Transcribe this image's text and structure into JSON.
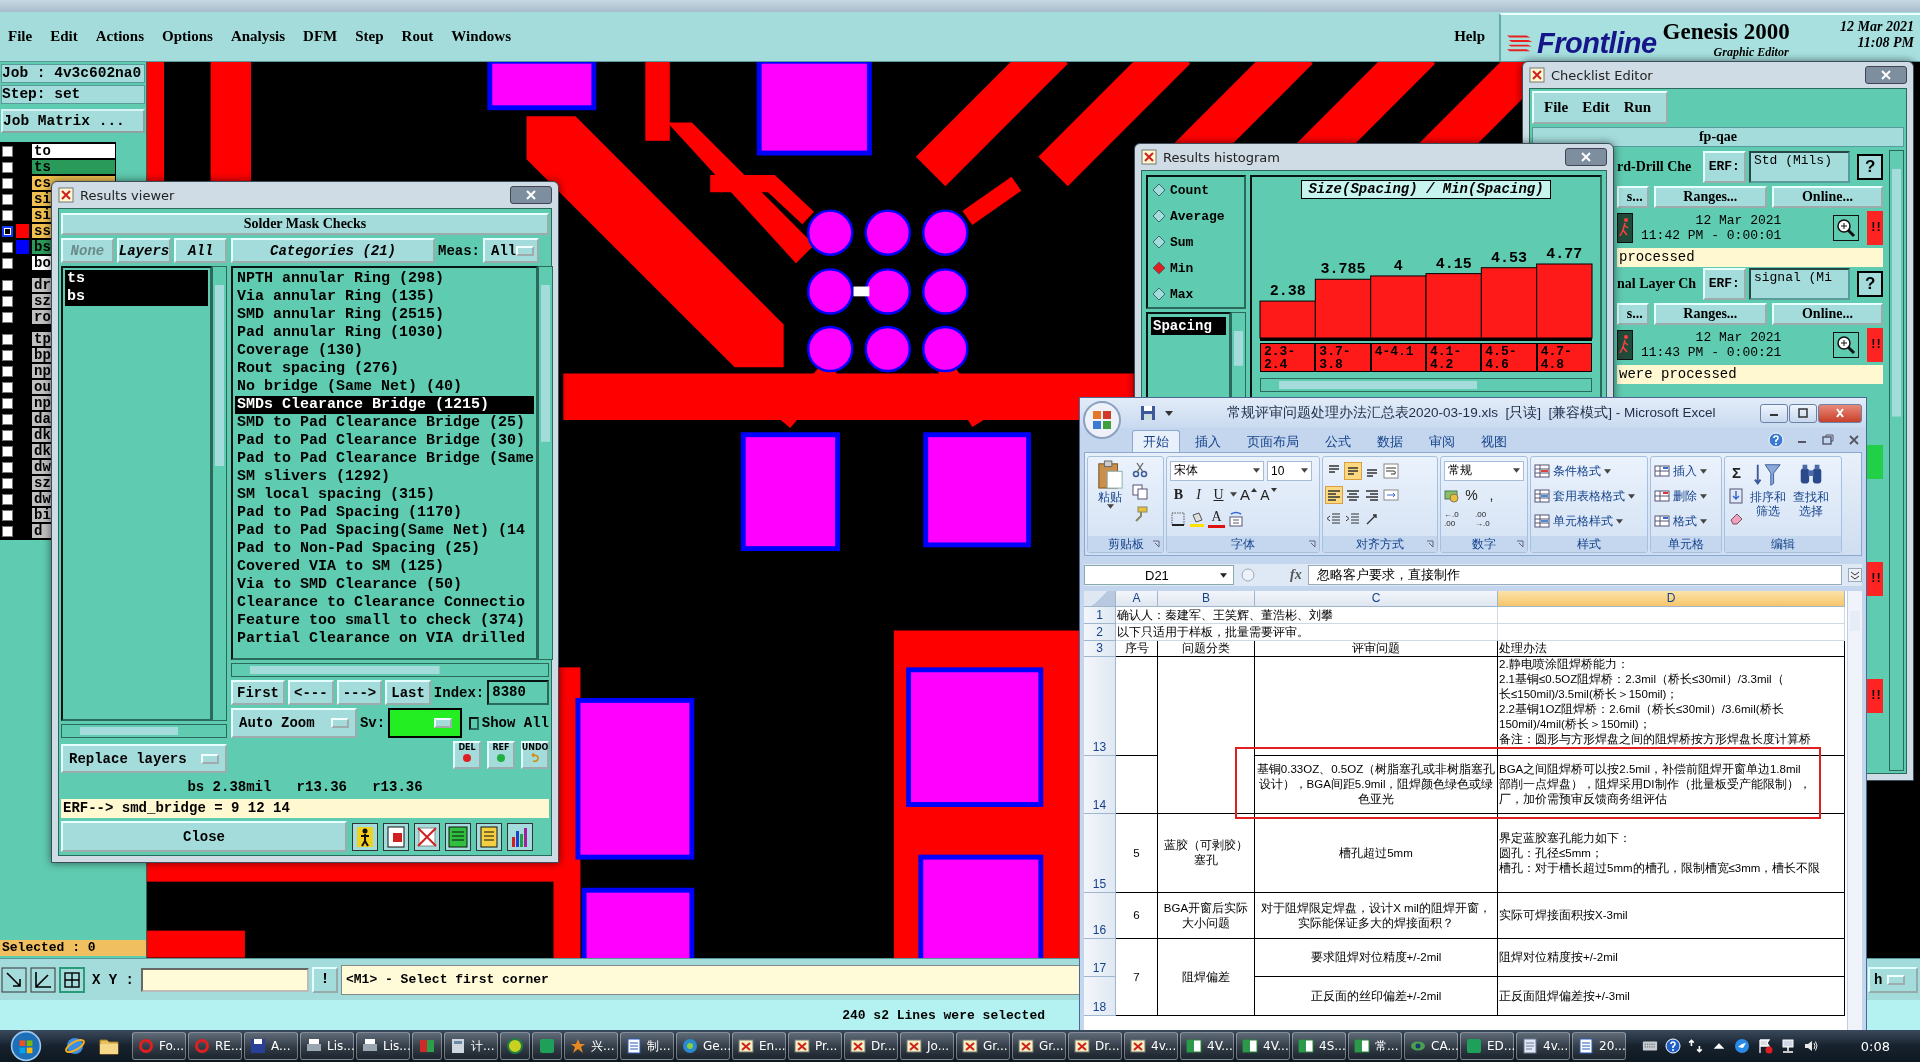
{
  "menu": {
    "items": [
      "File",
      "Edit",
      "Actions",
      "Options",
      "Analysis",
      "DFM",
      "Step",
      "Rout",
      "Windows"
    ],
    "help": "Help"
  },
  "logo": {
    "brand": "Frontline",
    "product": "Genesis 2000",
    "subtitle": "Graphic Editor",
    "date": "12 Mar 2021",
    "time": "11:08 PM"
  },
  "job_panel": {
    "job": "Job : 4v3c602na0",
    "step": "Step: set",
    "matrix_button": "Job Matrix ...",
    "layer_groups": [
      {
        "layers": [
          {
            "name": "to",
            "color": "#ffffff",
            "affected": false
          },
          {
            "name": "ts",
            "color": "#2a9a5a",
            "affected": false
          },
          {
            "name": "cs",
            "color": "#f0c050",
            "affected": false
          },
          {
            "name": "si",
            "color": "#f0c050",
            "affected": false
          },
          {
            "name": "si",
            "color": "#f0c050",
            "affected": false
          },
          {
            "name": "ss",
            "color": "#f0c050",
            "affected": true,
            "display": {
              "color": "#ff0000"
            }
          },
          {
            "name": "bs",
            "color": "#2a9a5a",
            "affected": false,
            "display": {
              "color": "#0000ff"
            }
          },
          {
            "name": "bo",
            "color": "#ffffff",
            "affected": false
          }
        ]
      },
      {
        "layers": [
          {
            "name": "dr",
            "color": "#c0c0c0",
            "affected": false
          },
          {
            "name": "sz",
            "color": "#c0c0c0",
            "affected": false
          },
          {
            "name": "ro",
            "color": "#c0c0c0",
            "affected": false
          }
        ]
      },
      {
        "layers": [
          {
            "name": "tp",
            "color": "#c0c0c0",
            "affected": false
          },
          {
            "name": "bp",
            "color": "#c0c0c0",
            "affected": false
          },
          {
            "name": "np",
            "color": "#c0c0c0",
            "affected": false
          },
          {
            "name": "ou",
            "color": "#c0c0c0",
            "affected": false
          },
          {
            "name": "np",
            "color": "#c0c0c0",
            "affected": false
          },
          {
            "name": "da",
            "color": "#c0c0c0",
            "affected": false
          },
          {
            "name": "dk",
            "color": "#c0c0c0",
            "affected": false
          },
          {
            "name": "dk",
            "color": "#c0c0c0",
            "affected": false
          },
          {
            "name": "dw",
            "color": "#c0c0c0",
            "affected": false
          },
          {
            "name": "sz",
            "color": "#c0c0c0",
            "affected": false
          },
          {
            "name": "dw",
            "color": "#c0c0c0",
            "affected": false
          },
          {
            "name": "bi",
            "color": "#c0c0c0",
            "affected": false
          },
          {
            "name": "d",
            "color": "#c0c0c0",
            "affected": false
          }
        ]
      }
    ],
    "selected_count": "Selected : 0"
  },
  "results_viewer": {
    "title": "Results viewer",
    "heading": "Solder Mask Checks",
    "layer_buttons": [
      {
        "label": "None",
        "disabled": true
      },
      {
        "label": "Layers",
        "disabled": false
      },
      {
        "label": "All",
        "disabled": false
      }
    ],
    "layers": [
      {
        "name": "ts",
        "selected": true
      },
      {
        "name": "bs",
        "selected": true
      }
    ],
    "replace_button": "Replace layers",
    "categories_button": "Categories (21)",
    "meas_label": "Meas:",
    "meas_value": "All",
    "categories": [
      {
        "label": "NPTH annular Ring (298)",
        "selected": false
      },
      {
        "label": "Via annular Ring (135)",
        "selected": false
      },
      {
        "label": "SMD annular Ring (2515)",
        "selected": false
      },
      {
        "label": "Pad annular Ring (1030)",
        "selected": false
      },
      {
        "label": "Coverage (130)",
        "selected": false
      },
      {
        "label": "Rout spacing (276)",
        "selected": false
      },
      {
        "label": "No bridge (Same Net) (40)",
        "selected": false
      },
      {
        "label": "SMDs Clearance Bridge (1215)",
        "selected": true
      },
      {
        "label": "SMD to Pad Clearance Bridge (25)",
        "selected": false
      },
      {
        "label": "Pad to Pad Clearance Bridge (30)",
        "selected": false
      },
      {
        "label": "Pad to Pad Clearance Bridge (Same",
        "selected": false
      },
      {
        "label": "SM slivers (1292)",
        "selected": false
      },
      {
        "label": "SM local spacing (315)",
        "selected": false
      },
      {
        "label": "Pad to Pad Spacing (1170)",
        "selected": false
      },
      {
        "label": "Pad to Pad Spacing(Same Net) (14",
        "selected": false
      },
      {
        "label": "Pad to Non-Pad Spacing (25)",
        "selected": false
      },
      {
        "label": "Covered VIA to SM (125)",
        "selected": false
      },
      {
        "label": "Via to SMD Clearance (50)",
        "selected": false
      },
      {
        "label": "Clearance to Clearance Connectio",
        "selected": false
      },
      {
        "label": "Feature too small to check (374)",
        "selected": false
      },
      {
        "label": "Partial Clearance on VIA drilled",
        "selected": false
      }
    ],
    "nav_buttons": [
      "First",
      "<---",
      "--->",
      "Last"
    ],
    "index_label": "Index:",
    "index_value": "8380",
    "zoom_option": "Auto Zoom",
    "sv_label": "Sv:",
    "show_all": {
      "label": "Show All",
      "checked": false
    },
    "tool_buttons": [
      {
        "label": "DEL",
        "kind": "delete"
      },
      {
        "label": "REF",
        "kind": "refresh"
      },
      {
        "label": "UNDO",
        "kind": "undo"
      }
    ],
    "measurement": "bs 2.38mil   r13.36   r13.36",
    "erf": "ERF--> smd_bridge = 9 12 14",
    "close_button": "Close"
  },
  "histogram": {
    "title": "Results histogram",
    "modes": [
      {
        "label": "Count",
        "selected": false
      },
      {
        "label": "Average",
        "selected": false
      },
      {
        "label": "Sum",
        "selected": false
      },
      {
        "label": "Min",
        "selected": true
      },
      {
        "label": "Max",
        "selected": false
      }
    ],
    "fields": [
      {
        "label": "Spacing",
        "selected": true
      }
    ],
    "chart_data": {
      "type": "bar",
      "title": "Size(Spacing) / Min(Spacing)",
      "categories": [
        "2.3-2.4",
        "3.7-3.8",
        "4-4.1",
        "4.1-4.2",
        "4.5-4.6",
        "4.7-4.8"
      ],
      "values": [
        2.38,
        3.785,
        4,
        4.15,
        4.53,
        4.77
      ],
      "data_labels": true
    }
  },
  "checklist_editor": {
    "title": "Checklist Editor",
    "menu": [
      "File",
      "Edit",
      "Run"
    ],
    "name": "fp-qae",
    "checks": [
      {
        "name": "rd-Drill Che",
        "erf_button": "ERF:",
        "erf_value": "Std (Mils)",
        "help_button": "?",
        "buttons": [
          "s...",
          "Ranges...",
          "Online..."
        ],
        "date": "12 Mar 2021",
        "time": "11:42 PM - 0:00:01",
        "color": "#ff2424",
        "status_text": "!!",
        "message": "processed"
      },
      {
        "name": "nal Layer Ch",
        "erf_button": "ERF:",
        "erf_value": "signal (Mi",
        "help_button": "?",
        "buttons": [
          "s...",
          "Ranges...",
          "Online..."
        ],
        "date": "12 Mar 2021",
        "time": "11:43 PM - 0:00:21",
        "color": "#ff2424",
        "status_text": "!!",
        "message": "were processed"
      },
      {
        "color": "#22d048"
      },
      {
        "color": "#ff2424",
        "status_text": "!!"
      },
      {
        "color": "#ff2424",
        "status_text": "!!"
      }
    ]
  },
  "command_bar": {
    "xy_label": "X Y :",
    "alert_button": "!",
    "prompt": "<M1> - Select first corner",
    "option": "h"
  },
  "message_bar": {
    "text": "240 s2 Lines were selected"
  },
  "excel": {
    "title": "常规评审问题处理办法汇总表2020-03-19.xls  [只读]  [兼容模式] - Microsoft Excel",
    "ribbon": {
      "tabs": [
        {
          "label": "开始",
          "selected": true
        },
        {
          "label": "插入",
          "selected": false
        },
        {
          "label": "页面布局",
          "selected": false
        },
        {
          "label": "公式",
          "selected": false
        },
        {
          "label": "数据",
          "selected": false
        },
        {
          "label": "审阅",
          "selected": false
        },
        {
          "label": "视图",
          "selected": false
        }
      ],
      "clipboard": {
        "label": "剪贴板",
        "paste": "粘贴"
      },
      "font": {
        "label": "字体",
        "face": "宋体",
        "size": "10",
        "bold": "B",
        "italic": "I",
        "underline": "U",
        "grow": "A",
        "shrink": "A",
        "font_tint": "A"
      },
      "alignment": {
        "label": "对齐方式",
        "vertical_buttons": [
          {
            "selected": false
          },
          {
            "selected": true
          },
          {
            "selected": false
          }
        ],
        "horizontal_buttons": [
          {
            "selected": true
          },
          {
            "selected": false
          },
          {
            "selected": false
          }
        ]
      },
      "number": {
        "label": "数字",
        "format": "常规",
        "percent": "%",
        "comma": ",",
        "more_decimals": "←.0 .00",
        "fewer_decimals": ".00 →.0"
      },
      "styles": {
        "label": "样式",
        "items": [
          "条件格式",
          "套用表格格式",
          "单元格样式"
        ]
      },
      "cells": {
        "label": "单元格",
        "items": [
          "插入",
          "删除",
          "格式"
        ]
      },
      "editing": {
        "label": "编辑",
        "sum": "Σ",
        "sort": "排序和筛选",
        "find": "查找和选择"
      }
    },
    "name_box": "D21",
    "function_label": "fx",
    "formula": "忽略客户要求，直接制作",
    "columns": [
      {
        "label": "A",
        "selected": false
      },
      {
        "label": "B",
        "selected": false
      },
      {
        "label": "C",
        "selected": false
      },
      {
        "label": "D",
        "selected": true
      }
    ],
    "rows": [
      {
        "number": "1",
        "kind": "note",
        "outlined": false,
        "cells": {
          "a": {
            "text": "确认人：秦建军、王笑辉、董浩彬、刘攀"
          }
        }
      },
      {
        "number": "2",
        "kind": "note",
        "outlined": false,
        "cells": {
          "a": {
            "text": "以下只适用于样板，批量需要评审。"
          }
        }
      },
      {
        "number": "3",
        "kind": "header",
        "outlined": false,
        "cells": {
          "a": {
            "text": "序号"
          },
          "b": {
            "text": "问题分类"
          },
          "c": {
            "text": "评审问题"
          },
          "d": {
            "text": "处理办法"
          }
        }
      },
      {
        "number": "13",
        "kind": "partial",
        "outlined": false,
        "cells": {
          "b": {
            "merged_down": true
          },
          "d": {
            "lines": [
              "2.静电喷涂阻焊桥能力：",
              "2.1基铜≤0.5OZ阻焊桥：2.3mil（桥长≤30mil）/3.3mil（",
              "长≤150mil)/3.5mil(桥长＞150mil)；",
              "2.2基铜1OZ阻焊桥：2.6mil（桥长≤30mil）/3.6mil(桥长",
              "150mil)/4mil(桥长＞150mil)；",
              "备注：圆形与方形焊盘之间的阻焊桥按方形焊盘长度计算桥"
            ]
          }
        }
      },
      {
        "number": "14",
        "kind": "data",
        "outlined": true,
        "cells": {
          "c": {
            "text": "基铜0.33OZ、0.5OZ（树脂塞孔或非树脂塞孔设计），BGA间距5.9mil，阻焊颜色绿色或绿色亚光"
          },
          "d": {
            "lines": [
              "BGA之间阻焊桥可以按2.5mil，补偿前阻焊开窗单边1.8mil",
              "部削一点焊盘），阻焊采用DI制作（批量板受产能限制），",
              "厂，加价需预审反馈商务组评估"
            ]
          }
        }
      },
      {
        "number": "15",
        "kind": "data",
        "outlined": false,
        "cells": {
          "a": {
            "text": "5"
          },
          "b": {
            "text": "蓝胶（可剥胶）塞孔"
          },
          "c": {
            "text": "槽孔超过5mm"
          },
          "d": {
            "lines": [
              "界定蓝胶塞孔能力如下：",
              "圆孔：孔径≤5mm；",
              "槽孔：对于槽长超过5mm的槽孔，限制槽宽≤3mm，槽长不限"
            ]
          }
        }
      },
      {
        "number": "16",
        "kind": "data",
        "outlined": false,
        "cells": {
          "a": {
            "text": "6"
          },
          "b": {
            "text": "BGA开窗后实际大小问题"
          },
          "c": {
            "text": "对于阻焊限定焊盘，设计X mil的阻焊开窗，实际能保证多大的焊接面积？"
          },
          "d": {
            "text": "实际可焊接面积按X-3mil"
          }
        }
      },
      {
        "number": "17",
        "kind": "data",
        "outlined": false,
        "cells": {
          "a": {
            "text": "7",
            "merged_down": true
          },
          "b": {
            "text": "阻焊偏差",
            "merged_down": true
          },
          "c": {
            "text": "要求阻焊对位精度+/-2mil"
          },
          "d": {
            "text": "阻焊对位精度按+/-2mil"
          }
        }
      },
      {
        "number": "18",
        "kind": "data",
        "outlined": false,
        "cells": {
          "c": {
            "text": "正反面的丝印偏差+/-2mil"
          },
          "d": {
            "text": "正反面阻焊偏差按+/-3mil"
          }
        }
      }
    ]
  },
  "taskbar": {
    "tasks": [
      {
        "label": "Fo...",
        "kind": "swirl"
      },
      {
        "label": "RE...",
        "kind": "swirl"
      },
      {
        "label": "A...",
        "kind": "disk"
      },
      {
        "label": "Lis...",
        "kind": "printer"
      },
      {
        "label": "Lis...",
        "kind": "printer"
      },
      {
        "kind": "book"
      },
      {
        "label": "计...",
        "kind": "calc"
      },
      {
        "kind": "orb"
      },
      {
        "kind": "tile"
      },
      {
        "label": "兴...",
        "kind": "star"
      },
      {
        "label": "制...",
        "kind": "doc"
      },
      {
        "label": "Ge...",
        "kind": "gear"
      },
      {
        "label": "En...",
        "kind": "window"
      },
      {
        "label": "Pr...",
        "kind": "window"
      },
      {
        "label": "Dr...",
        "kind": "window"
      },
      {
        "label": "Jo...",
        "kind": "window"
      },
      {
        "label": "Gr...",
        "kind": "window"
      },
      {
        "label": "Gr...",
        "kind": "window"
      },
      {
        "label": "Dr...",
        "kind": "window"
      },
      {
        "label": "4v...",
        "kind": "window"
      },
      {
        "label": "4V...",
        "kind": "sheet"
      },
      {
        "label": "4V...",
        "kind": "sheet"
      },
      {
        "label": "4S...",
        "kind": "sheet"
      },
      {
        "label": "常...",
        "kind": "sheet"
      },
      {
        "label": "CA...",
        "kind": "eye"
      },
      {
        "label": "ED...",
        "kind": "tile"
      },
      {
        "label": "4v...",
        "kind": "note"
      },
      {
        "label": "20...",
        "kind": "doc"
      }
    ],
    "clock": "0:08"
  }
}
